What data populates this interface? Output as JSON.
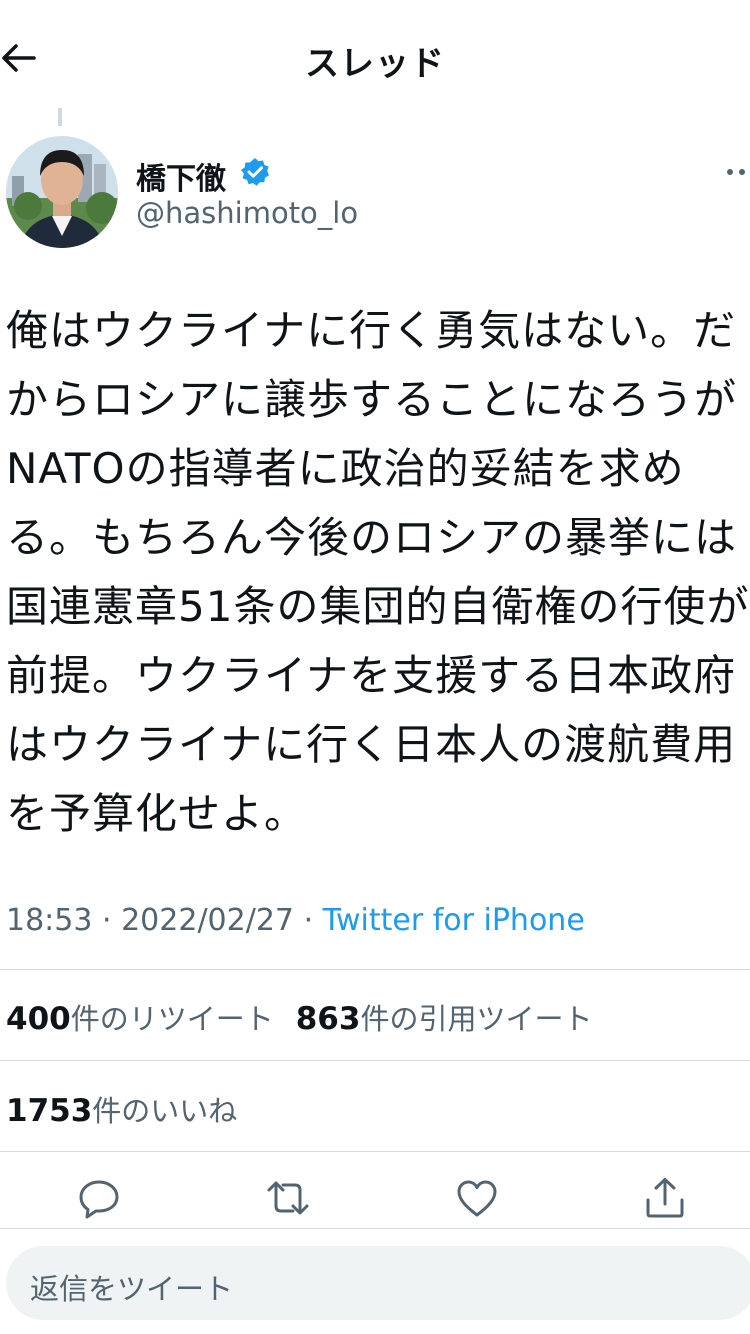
{
  "header": {
    "title": "スレッド",
    "back_icon": "arrow-left-icon"
  },
  "author": {
    "display_name": "橋下徹",
    "handle": "@hashimoto_lo",
    "verified": true,
    "verified_color": "#1d9bf0"
  },
  "tweet": {
    "text": "俺はウクライナに行く勇気はない。だからロシアに譲歩することになろうがNATOの指導者に政治的妥結を求める。もちろん今後のロシアの暴挙には国連憲章51条の集団的自衛権の行使が前提。ウクライナを支援する日本政府はウクライナに行く日本人の渡航費用を予算化せよ。",
    "time": "18:53",
    "date": "2022/02/27",
    "source": "Twitter for iPhone"
  },
  "stats": {
    "retweets_count": "400",
    "retweets_label": "件のリツイート",
    "quotes_count": "863",
    "quotes_label": "件の引用ツイート",
    "likes_count": "1753",
    "likes_label": "件のいいね"
  },
  "actions": [
    "reply-icon",
    "retweet-icon",
    "like-icon",
    "share-icon"
  ],
  "reply": {
    "placeholder": "返信をツイート"
  },
  "colors": {
    "accent": "#1d9bf0",
    "text": "#0f1419",
    "secondary": "#536471"
  }
}
